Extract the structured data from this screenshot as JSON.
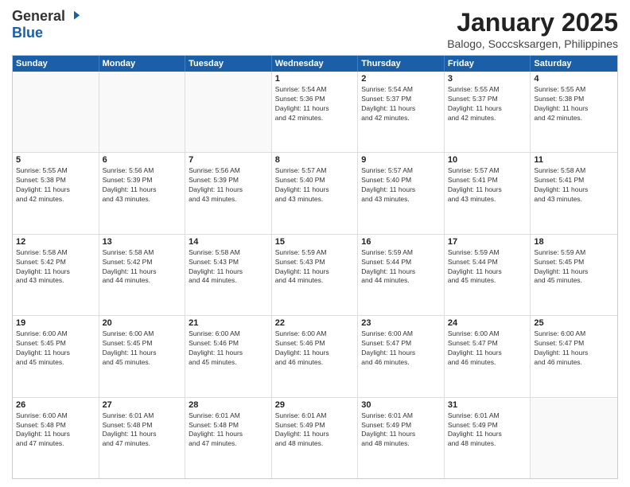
{
  "logo": {
    "general": "General",
    "blue": "Blue"
  },
  "title": "January 2025",
  "subtitle": "Balogo, Soccsksargen, Philippines",
  "header_days": [
    "Sunday",
    "Monday",
    "Tuesday",
    "Wednesday",
    "Thursday",
    "Friday",
    "Saturday"
  ],
  "weeks": [
    [
      {
        "day": "",
        "info": ""
      },
      {
        "day": "",
        "info": ""
      },
      {
        "day": "",
        "info": ""
      },
      {
        "day": "1",
        "info": "Sunrise: 5:54 AM\nSunset: 5:36 PM\nDaylight: 11 hours\nand 42 minutes."
      },
      {
        "day": "2",
        "info": "Sunrise: 5:54 AM\nSunset: 5:37 PM\nDaylight: 11 hours\nand 42 minutes."
      },
      {
        "day": "3",
        "info": "Sunrise: 5:55 AM\nSunset: 5:37 PM\nDaylight: 11 hours\nand 42 minutes."
      },
      {
        "day": "4",
        "info": "Sunrise: 5:55 AM\nSunset: 5:38 PM\nDaylight: 11 hours\nand 42 minutes."
      }
    ],
    [
      {
        "day": "5",
        "info": "Sunrise: 5:55 AM\nSunset: 5:38 PM\nDaylight: 11 hours\nand 42 minutes."
      },
      {
        "day": "6",
        "info": "Sunrise: 5:56 AM\nSunset: 5:39 PM\nDaylight: 11 hours\nand 43 minutes."
      },
      {
        "day": "7",
        "info": "Sunrise: 5:56 AM\nSunset: 5:39 PM\nDaylight: 11 hours\nand 43 minutes."
      },
      {
        "day": "8",
        "info": "Sunrise: 5:57 AM\nSunset: 5:40 PM\nDaylight: 11 hours\nand 43 minutes."
      },
      {
        "day": "9",
        "info": "Sunrise: 5:57 AM\nSunset: 5:40 PM\nDaylight: 11 hours\nand 43 minutes."
      },
      {
        "day": "10",
        "info": "Sunrise: 5:57 AM\nSunset: 5:41 PM\nDaylight: 11 hours\nand 43 minutes."
      },
      {
        "day": "11",
        "info": "Sunrise: 5:58 AM\nSunset: 5:41 PM\nDaylight: 11 hours\nand 43 minutes."
      }
    ],
    [
      {
        "day": "12",
        "info": "Sunrise: 5:58 AM\nSunset: 5:42 PM\nDaylight: 11 hours\nand 43 minutes."
      },
      {
        "day": "13",
        "info": "Sunrise: 5:58 AM\nSunset: 5:42 PM\nDaylight: 11 hours\nand 44 minutes."
      },
      {
        "day": "14",
        "info": "Sunrise: 5:58 AM\nSunset: 5:43 PM\nDaylight: 11 hours\nand 44 minutes."
      },
      {
        "day": "15",
        "info": "Sunrise: 5:59 AM\nSunset: 5:43 PM\nDaylight: 11 hours\nand 44 minutes."
      },
      {
        "day": "16",
        "info": "Sunrise: 5:59 AM\nSunset: 5:44 PM\nDaylight: 11 hours\nand 44 minutes."
      },
      {
        "day": "17",
        "info": "Sunrise: 5:59 AM\nSunset: 5:44 PM\nDaylight: 11 hours\nand 45 minutes."
      },
      {
        "day": "18",
        "info": "Sunrise: 5:59 AM\nSunset: 5:45 PM\nDaylight: 11 hours\nand 45 minutes."
      }
    ],
    [
      {
        "day": "19",
        "info": "Sunrise: 6:00 AM\nSunset: 5:45 PM\nDaylight: 11 hours\nand 45 minutes."
      },
      {
        "day": "20",
        "info": "Sunrise: 6:00 AM\nSunset: 5:45 PM\nDaylight: 11 hours\nand 45 minutes."
      },
      {
        "day": "21",
        "info": "Sunrise: 6:00 AM\nSunset: 5:46 PM\nDaylight: 11 hours\nand 45 minutes."
      },
      {
        "day": "22",
        "info": "Sunrise: 6:00 AM\nSunset: 5:46 PM\nDaylight: 11 hours\nand 46 minutes."
      },
      {
        "day": "23",
        "info": "Sunrise: 6:00 AM\nSunset: 5:47 PM\nDaylight: 11 hours\nand 46 minutes."
      },
      {
        "day": "24",
        "info": "Sunrise: 6:00 AM\nSunset: 5:47 PM\nDaylight: 11 hours\nand 46 minutes."
      },
      {
        "day": "25",
        "info": "Sunrise: 6:00 AM\nSunset: 5:47 PM\nDaylight: 11 hours\nand 46 minutes."
      }
    ],
    [
      {
        "day": "26",
        "info": "Sunrise: 6:00 AM\nSunset: 5:48 PM\nDaylight: 11 hours\nand 47 minutes."
      },
      {
        "day": "27",
        "info": "Sunrise: 6:01 AM\nSunset: 5:48 PM\nDaylight: 11 hours\nand 47 minutes."
      },
      {
        "day": "28",
        "info": "Sunrise: 6:01 AM\nSunset: 5:48 PM\nDaylight: 11 hours\nand 47 minutes."
      },
      {
        "day": "29",
        "info": "Sunrise: 6:01 AM\nSunset: 5:49 PM\nDaylight: 11 hours\nand 48 minutes."
      },
      {
        "day": "30",
        "info": "Sunrise: 6:01 AM\nSunset: 5:49 PM\nDaylight: 11 hours\nand 48 minutes."
      },
      {
        "day": "31",
        "info": "Sunrise: 6:01 AM\nSunset: 5:49 PM\nDaylight: 11 hours\nand 48 minutes."
      },
      {
        "day": "",
        "info": ""
      }
    ]
  ]
}
